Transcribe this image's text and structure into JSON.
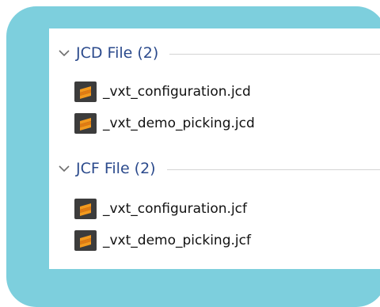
{
  "groups": [
    {
      "title": "JCD File (2)",
      "items": [
        {
          "name": "_vxt_configuration.jcd",
          "icon": "sublime-file-icon"
        },
        {
          "name": "_vxt_demo_picking.jcd",
          "icon": "sublime-file-icon"
        }
      ]
    },
    {
      "title": "JCF File (2)",
      "items": [
        {
          "name": "_vxt_configuration.jcf",
          "icon": "sublime-file-icon"
        },
        {
          "name": "_vxt_demo_picking.jcf",
          "icon": "sublime-file-icon"
        }
      ]
    }
  ],
  "colors": {
    "frame": "#7dcfdd",
    "group_title": "#2b4a8c",
    "icon_bg": "#3c3c3c",
    "icon_accent": "#f39a1e"
  }
}
